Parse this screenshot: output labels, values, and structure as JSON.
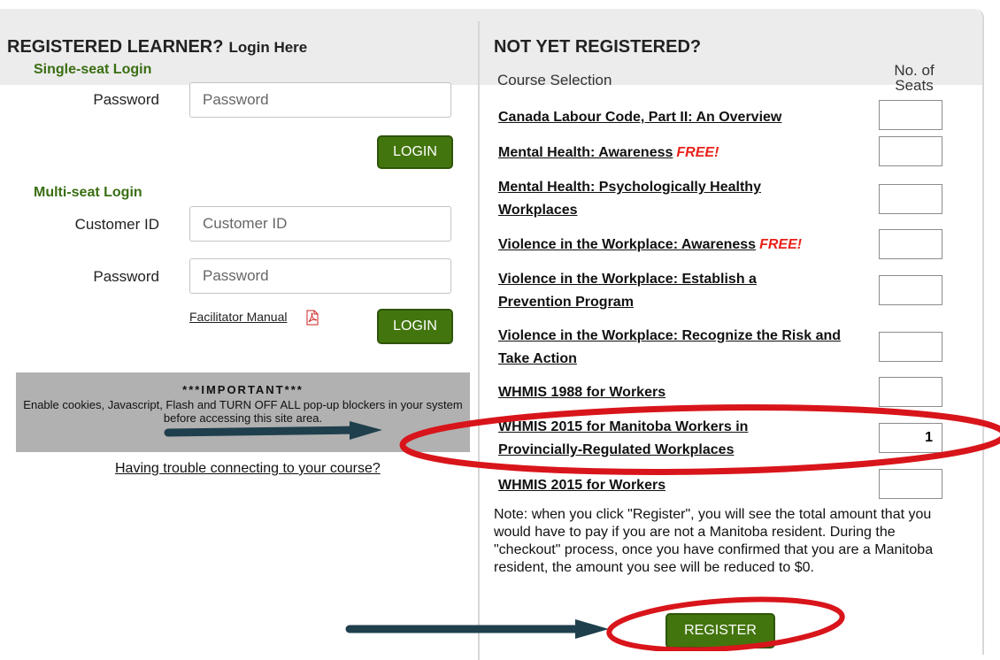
{
  "left": {
    "heading": "REGISTERED LEARNER?",
    "heading_small": "Login Here",
    "single_seat_title": "Single-seat Login",
    "single_password_label": "Password",
    "single_password_placeholder": "Password",
    "login_label": "LOGIN",
    "multi_seat_title": "Multi-seat Login",
    "customer_id_label": "Customer ID",
    "customer_id_placeholder": "Customer ID",
    "multi_password_label": "Password",
    "multi_password_placeholder": "Password",
    "facilitator_manual": "Facilitator Manual",
    "important_title": "***IMPORTANT***",
    "important_body": "Enable cookies, Javascript, Flash and TURN OFF ALL pop-up blockers in your system before accessing this site area.",
    "trouble_link": "Having trouble connecting to your course?"
  },
  "right": {
    "heading": "NOT YET REGISTERED?",
    "course_selection": "Course Selection",
    "seats_header_line1": "No. of",
    "seats_header_line2": "Seats",
    "courses": [
      {
        "title": "Canada Labour Code, Part II: An Overview",
        "free": "",
        "seats": ""
      },
      {
        "title": "Mental Health: Awareness",
        "free": "FREE!",
        "seats": ""
      },
      {
        "title": "Mental Health: Psychologically Healthy Workplaces",
        "free": "",
        "seats": ""
      },
      {
        "title": "Violence in the Workplace: Awareness",
        "free": "FREE!",
        "seats": ""
      },
      {
        "title": "Violence in the Workplace: Establish a Prevention Program",
        "free": "",
        "seats": ""
      },
      {
        "title": "Violence in the Workplace: Recognize the Risk and Take Action",
        "free": "",
        "seats": ""
      },
      {
        "title": "WHMIS 1988 for Workers",
        "free": "",
        "seats": ""
      },
      {
        "title": "WHMIS 2015 for Manitoba Workers in Provincially-Regulated Workplaces",
        "free": "",
        "seats": "1"
      },
      {
        "title": "WHMIS 2015 for Workers",
        "free": "",
        "seats": ""
      }
    ],
    "note": "Note: when you click \"Register\", you will see the total amount that you would have to pay if you are not a Manitoba resident. During the \"checkout\" process, once you have confirmed that you are a Manitoba resident, the amount you see will be reduced to $0.",
    "register_label": "REGISTER"
  },
  "colors": {
    "button_green": "#43750e",
    "subtitle_green": "#3a6e12",
    "free_red": "#e8221a",
    "annotation_red": "#d8151b",
    "annotation_arrow": "#1f3f4c"
  },
  "icons": [
    "pdf-icon",
    "annotation-arrow-icon",
    "annotation-ellipse-icon"
  ]
}
